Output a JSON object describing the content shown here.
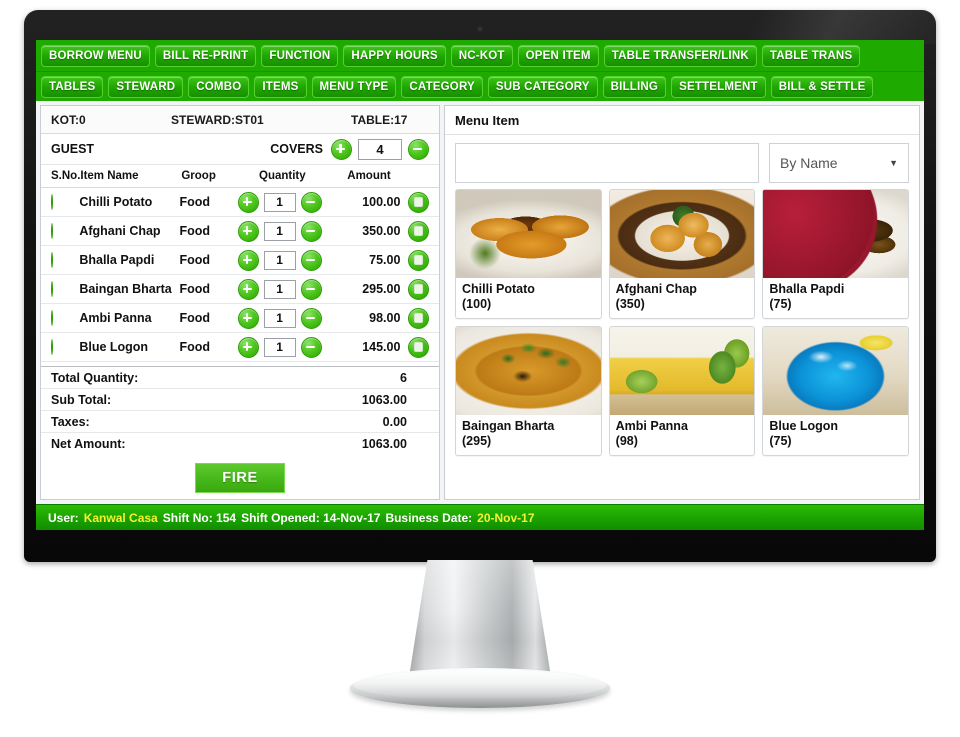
{
  "nav": {
    "row1": [
      "BORROW MENU",
      "BILL RE-PRINT",
      "FUNCTION",
      "HAPPY HOURS",
      "NC-KOT",
      "OPEN ITEM",
      "TABLE TRANSFER/LINK",
      "TABLE TRANS"
    ],
    "row2": [
      "TABLES",
      "STEWARD",
      "COMBO",
      "ITEMS",
      "MENU TYPE",
      "CATEGORY",
      "SUB CATEGORY",
      "BILLING",
      "SETTELMENT",
      "BILL & SETTLE"
    ]
  },
  "ticket": {
    "kot": "KOT:0",
    "steward": "STEWARD:ST01",
    "table": "TABLE:17",
    "guest_label": "GUEST",
    "covers_label": "COVERS",
    "covers_value": "4",
    "columns": {
      "sno": "S.No.",
      "item_name": "Item Name",
      "group": "Groop",
      "quantity": "Quantity",
      "amount": "Amount"
    },
    "rows": [
      {
        "name": "Chilli Potato",
        "group": "Food",
        "qty": "1",
        "amount": "100.00"
      },
      {
        "name": "Afghani Chap",
        "group": "Food",
        "qty": "1",
        "amount": "350.00"
      },
      {
        "name": "Bhalla Papdi",
        "group": "Food",
        "qty": "1",
        "amount": "75.00"
      },
      {
        "name": "Baingan Bharta",
        "group": "Food",
        "qty": "1",
        "amount": "295.00"
      },
      {
        "name": "Ambi Panna",
        "group": "Food",
        "qty": "1",
        "amount": "98.00"
      },
      {
        "name": "Blue Logon",
        "group": "Food",
        "qty": "1",
        "amount": "145.00"
      }
    ],
    "totals": [
      {
        "label": "Total Quantity:",
        "value": "6"
      },
      {
        "label": "Sub Total:",
        "value": "1063.00"
      },
      {
        "label": "Taxes:",
        "value": "0.00"
      },
      {
        "label": "Net Amount:",
        "value": "1063.00"
      }
    ],
    "fire_label": "FIRE"
  },
  "menu": {
    "title": "Menu Item",
    "search_value": "",
    "search_placeholder": "",
    "filter_selected": "By Name",
    "filter_options": [
      "By Name"
    ],
    "cards": [
      {
        "name": "Chilli Potato",
        "price": "(100)",
        "thumb": "chilli-potato-photo"
      },
      {
        "name": "Afghani Chap",
        "price": "(350)",
        "thumb": "afghani-chap-photo"
      },
      {
        "name": "Bhalla Papdi",
        "price": "(75)",
        "thumb": "bhalla-papdi-photo"
      },
      {
        "name": "Baingan Bharta",
        "price": "(295)",
        "thumb": "baingan-bharta-photo"
      },
      {
        "name": "Ambi Panna",
        "price": "(98)",
        "thumb": "ambi-panna-photo"
      },
      {
        "name": "Blue Logon",
        "price": "(75)",
        "thumb": "blue-logon-photo"
      }
    ]
  },
  "status": {
    "user_label": "User:",
    "user_name": "Kanwal Casa",
    "shift_no": "Shift No: 154",
    "shift_opened": "Shift Opened: 14-Nov-17",
    "business_date_label": "Business Date:",
    "business_date": "20-Nov-17"
  },
  "colors": {
    "brand_green": "#1faa00",
    "button_green": "#21a802",
    "status_highlight": "#f5f132",
    "bezel": "#111111"
  }
}
